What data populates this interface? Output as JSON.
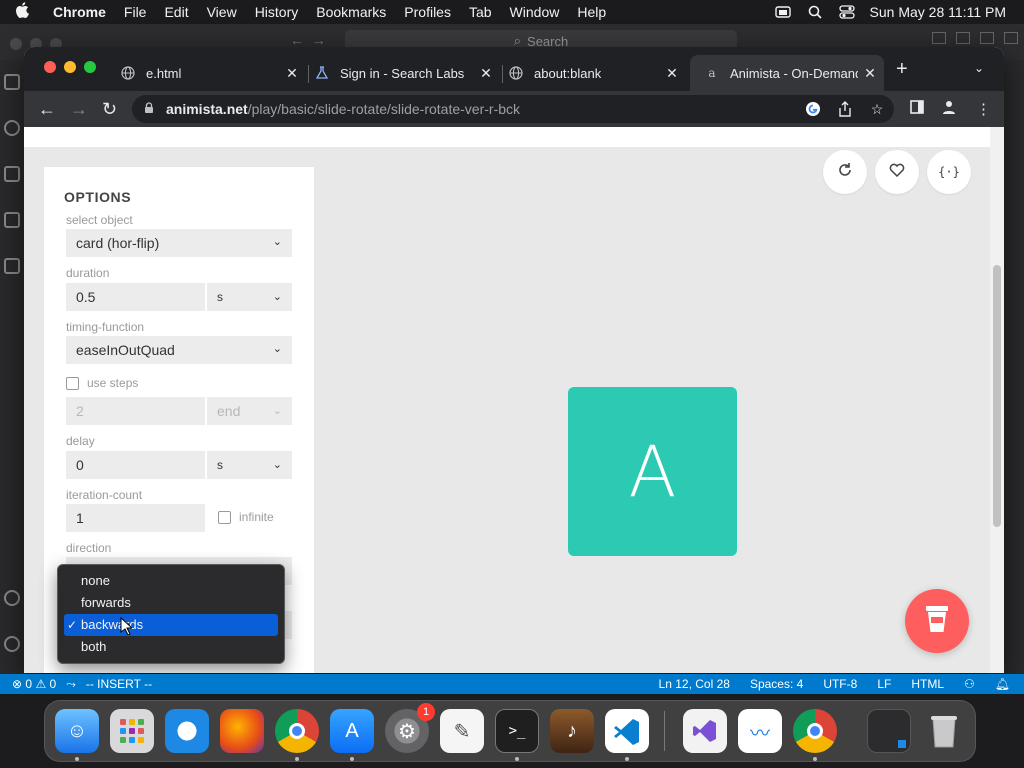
{
  "menubar": {
    "app_name": "Chrome",
    "items": [
      "File",
      "Edit",
      "View",
      "History",
      "Bookmarks",
      "Profiles",
      "Tab",
      "Window",
      "Help"
    ],
    "clock": "Sun May 28  11:11 PM"
  },
  "vscode": {
    "search_placeholder": "Search",
    "status": {
      "errors": "0",
      "warnings": "0",
      "mode": "-- INSERT --",
      "position": "Ln 12, Col 28",
      "spaces": "Spaces: 4",
      "encoding": "UTF-8",
      "eol": "LF",
      "language": "HTML"
    }
  },
  "browser": {
    "tabs": [
      {
        "title": "e.html",
        "icon": "globe-icon",
        "active": false
      },
      {
        "title": "Sign in - Search Labs",
        "icon": "flask-icon",
        "active": false
      },
      {
        "title": "about:blank",
        "icon": "globe-icon",
        "active": false
      },
      {
        "title": "Animista - On-Demand",
        "icon": "animista-icon",
        "active": true
      }
    ],
    "url_host": "animista.net",
    "url_path": "/play/basic/slide-rotate/slide-rotate-ver-r-bck"
  },
  "options": {
    "heading": "OPTIONS",
    "select_object_label": "select object",
    "select_object_value": "card (hor-flip)",
    "duration_label": "duration",
    "duration_value": "0.5",
    "duration_unit": "s",
    "timing_label": "timing-function",
    "timing_value": "easeInOutQuad",
    "use_steps_label": "use steps",
    "use_steps_checked": false,
    "steps_value": "2",
    "steps_mode": "end",
    "delay_label": "delay",
    "delay_value": "0",
    "delay_unit": "s",
    "iteration_label": "iteration-count",
    "iteration_value": "1",
    "infinite_label": "infinite",
    "infinite_checked": false,
    "direction_label": "direction"
  },
  "direction_dropdown": {
    "options": [
      "none",
      "forwards",
      "backwards",
      "both"
    ],
    "selected": "backwards"
  },
  "stage": {
    "card_letter": "A",
    "card_color": "#2cc9b3",
    "buttons": [
      "replay-icon",
      "heart-icon",
      "code-braces-icon"
    ],
    "coffee_color": "#ff5e5e"
  },
  "dock": {
    "apps": [
      "Finder",
      "Launchpad",
      "Safari",
      "Firefox",
      "Google Chrome",
      "App Store",
      "System Preferences",
      "TextEdit",
      "Terminal",
      "GarageBand",
      "Visual Studio Code",
      "Visual Studio",
      "Freeform",
      "Google Chrome",
      "Screen",
      "Trash"
    ],
    "settings_badge": "1"
  }
}
